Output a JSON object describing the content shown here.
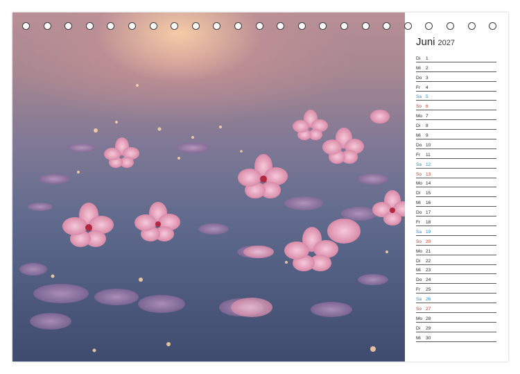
{
  "calendar": {
    "month": "Juni",
    "year": "2027",
    "days": [
      {
        "wd": "Di",
        "num": "1",
        "type": "weekday"
      },
      {
        "wd": "Mi",
        "num": "2",
        "type": "weekday"
      },
      {
        "wd": "Do",
        "num": "3",
        "type": "weekday"
      },
      {
        "wd": "Fr",
        "num": "4",
        "type": "weekday"
      },
      {
        "wd": "Sa",
        "num": "5",
        "type": "sat"
      },
      {
        "wd": "So",
        "num": "6",
        "type": "sun"
      },
      {
        "wd": "Mo",
        "num": "7",
        "type": "weekday"
      },
      {
        "wd": "Di",
        "num": "8",
        "type": "weekday"
      },
      {
        "wd": "Mi",
        "num": "9",
        "type": "weekday"
      },
      {
        "wd": "Do",
        "num": "10",
        "type": "weekday"
      },
      {
        "wd": "Fr",
        "num": "11",
        "type": "weekday"
      },
      {
        "wd": "Sa",
        "num": "12",
        "type": "sat"
      },
      {
        "wd": "So",
        "num": "13",
        "type": "sun"
      },
      {
        "wd": "Mo",
        "num": "14",
        "type": "weekday"
      },
      {
        "wd": "Di",
        "num": "15",
        "type": "weekday"
      },
      {
        "wd": "Mi",
        "num": "16",
        "type": "weekday"
      },
      {
        "wd": "Do",
        "num": "17",
        "type": "weekday"
      },
      {
        "wd": "Fr",
        "num": "18",
        "type": "weekday"
      },
      {
        "wd": "Sa",
        "num": "19",
        "type": "sat"
      },
      {
        "wd": "So",
        "num": "20",
        "type": "sun"
      },
      {
        "wd": "Mo",
        "num": "21",
        "type": "weekday"
      },
      {
        "wd": "Di",
        "num": "22",
        "type": "weekday"
      },
      {
        "wd": "Mi",
        "num": "23",
        "type": "weekday"
      },
      {
        "wd": "Do",
        "num": "24",
        "type": "weekday"
      },
      {
        "wd": "Fr",
        "num": "25",
        "type": "weekday"
      },
      {
        "wd": "Sa",
        "num": "26",
        "type": "sat"
      },
      {
        "wd": "So",
        "num": "27",
        "type": "sun"
      },
      {
        "wd": "Mo",
        "num": "28",
        "type": "weekday"
      },
      {
        "wd": "Di",
        "num": "29",
        "type": "weekday"
      },
      {
        "wd": "Mi",
        "num": "30",
        "type": "weekday"
      }
    ]
  },
  "colors": {
    "saturday": "#2a8bc4",
    "sunday": "#c2361f",
    "petal": "#e9a9c0"
  }
}
